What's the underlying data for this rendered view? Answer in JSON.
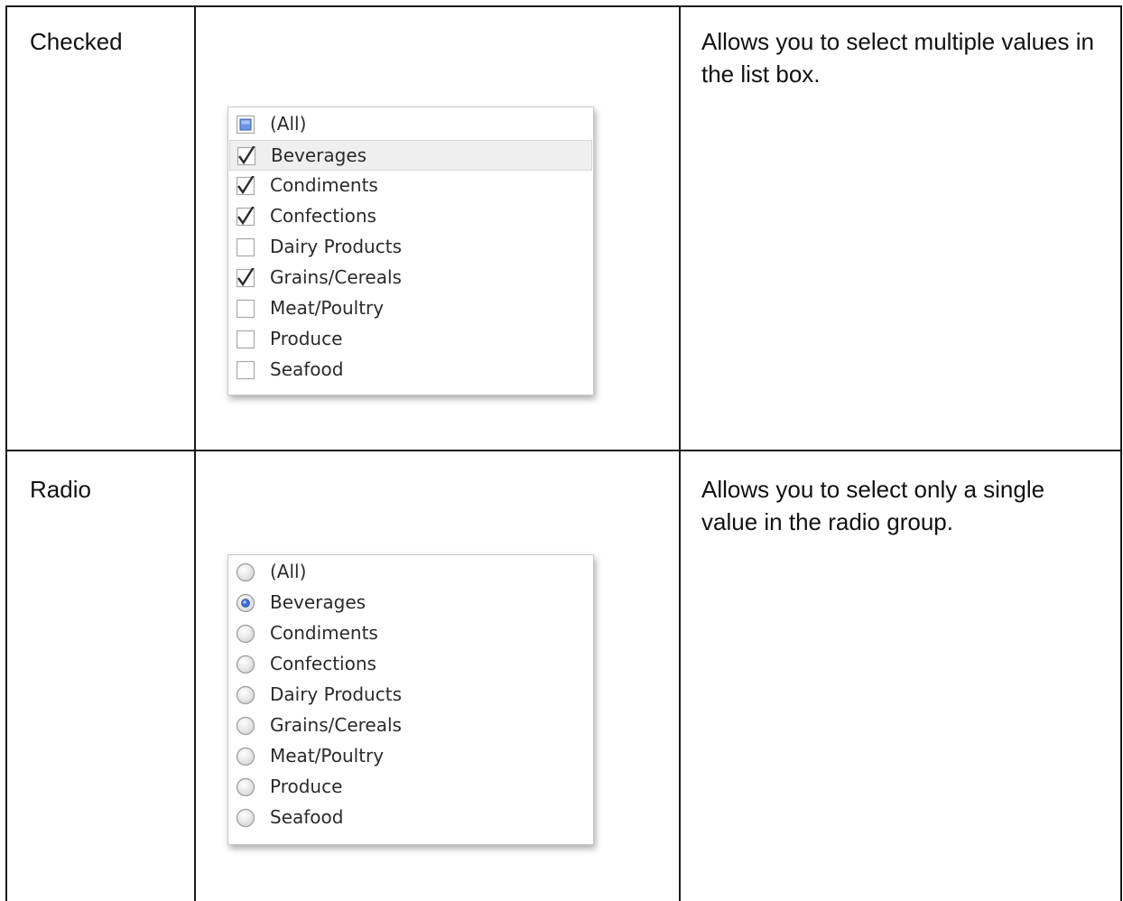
{
  "rows": [
    {
      "style_name": "Checked",
      "description": "Allows you to select multiple values in the list box.",
      "control": {
        "kind": "checkbox",
        "items": [
          {
            "label": "(All)",
            "state": "indeterminate"
          },
          {
            "label": "Beverages",
            "state": "checked",
            "hovered": true
          },
          {
            "label": "Condiments",
            "state": "checked"
          },
          {
            "label": "Confections",
            "state": "checked"
          },
          {
            "label": "Dairy Products",
            "state": "unchecked"
          },
          {
            "label": "Grains/Cereals",
            "state": "checked"
          },
          {
            "label": "Meat/Poultry",
            "state": "unchecked"
          },
          {
            "label": "Produce",
            "state": "unchecked"
          },
          {
            "label": "Seafood",
            "state": "unchecked"
          }
        ]
      }
    },
    {
      "style_name": "Radio",
      "description": "Allows you to select only a single value in the radio group.",
      "control": {
        "kind": "radio",
        "items": [
          {
            "label": "(All)",
            "state": "unselected"
          },
          {
            "label": "Beverages",
            "state": "selected"
          },
          {
            "label": "Condiments",
            "state": "unselected"
          },
          {
            "label": "Confections",
            "state": "unselected"
          },
          {
            "label": "Dairy Products",
            "state": "unselected"
          },
          {
            "label": "Grains/Cereals",
            "state": "unselected"
          },
          {
            "label": "Meat/Poultry",
            "state": "unselected"
          },
          {
            "label": "Produce",
            "state": "unselected"
          },
          {
            "label": "Seafood",
            "state": "unselected"
          }
        ]
      }
    }
  ],
  "colors": {
    "table_border": "#1a1a1a",
    "listbox_border": "#c8c8c8",
    "hover_row": "#efefef",
    "radio_selected": "#3b6fd8",
    "checkbox_indeterminate": "#6d95e6",
    "check_mark": "#2a2a2a"
  },
  "icons": {
    "checkbox": "checkbox-icon",
    "checkbox_checked": "checkmark-icon",
    "checkbox_indeterminate": "indeterminate-checkbox-icon",
    "radio": "radio-button-icon"
  }
}
